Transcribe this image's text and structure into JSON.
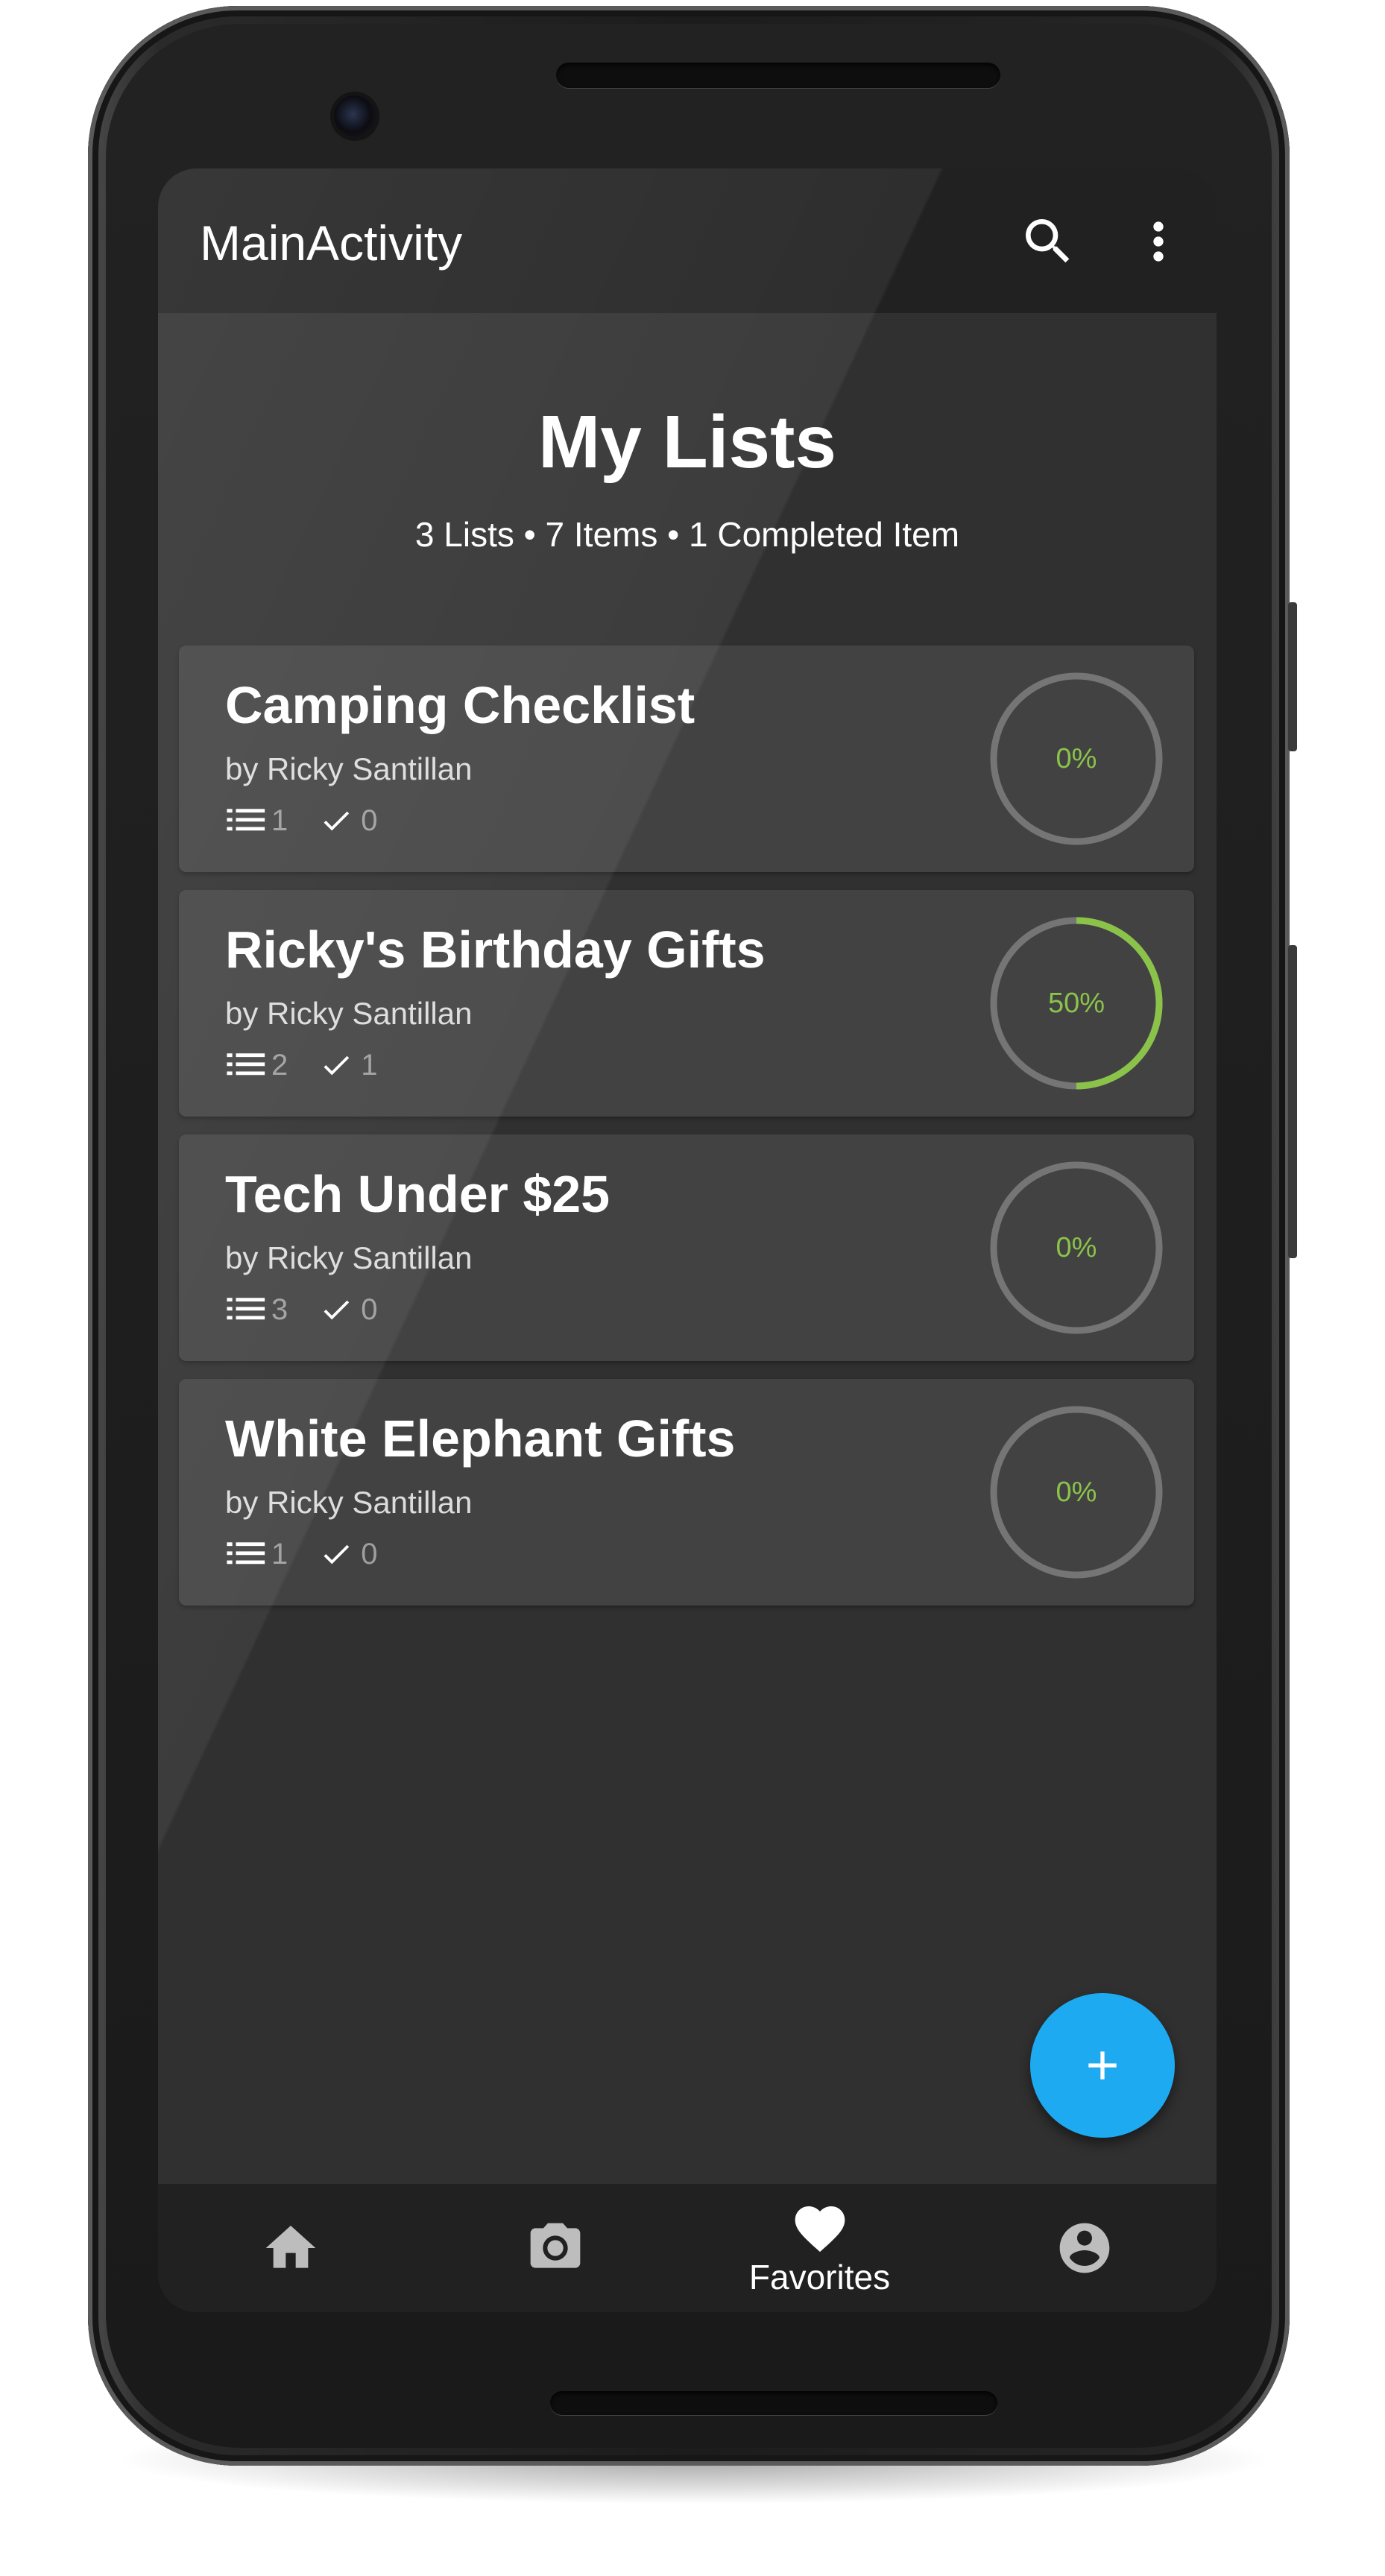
{
  "appbar": {
    "title": "MainActivity",
    "search_icon": "search-icon",
    "menu_icon": "more-vert-icon"
  },
  "header": {
    "title": "My Lists",
    "subtitle": "3 Lists • 7 Items • 1 Completed Item"
  },
  "lists": [
    {
      "title": "Camping Checklist",
      "author": "by Ricky Santillan",
      "items": "1",
      "completed": "0",
      "progress": 0,
      "progress_label": "0%"
    },
    {
      "title": "Ricky's Birthday Gifts",
      "author": "by Ricky Santillan",
      "items": "2",
      "completed": "1",
      "progress": 0.5,
      "progress_label": "50%"
    },
    {
      "title": "Tech Under $25",
      "author": "by Ricky Santillan",
      "items": "3",
      "completed": "0",
      "progress": 0,
      "progress_label": "0%"
    },
    {
      "title": "White Elephant Gifts",
      "author": "by Ricky Santillan",
      "items": "1",
      "completed": "0",
      "progress": 0,
      "progress_label": "0%"
    }
  ],
  "fab": {
    "icon": "add-icon"
  },
  "bottom_nav": {
    "items": [
      {
        "icon": "home-icon",
        "label": ""
      },
      {
        "icon": "camera-icon",
        "label": ""
      },
      {
        "icon": "favorite-icon",
        "label": "Favorites",
        "selected": true
      },
      {
        "icon": "account-icon",
        "label": ""
      }
    ]
  },
  "colors": {
    "background": "#303030",
    "appbar": "#212121",
    "card": "#424242",
    "progress": "#8bc34a",
    "ring_track": "#757575",
    "fab": "#1eaaf1"
  }
}
